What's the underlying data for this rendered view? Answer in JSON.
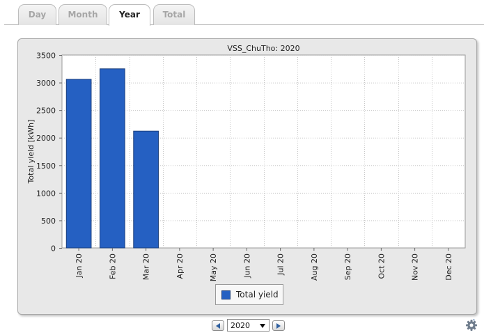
{
  "tabs": [
    {
      "label": "Day",
      "active": false
    },
    {
      "label": "Month",
      "active": false
    },
    {
      "label": "Year",
      "active": true
    },
    {
      "label": "Total",
      "active": false
    }
  ],
  "colors": {
    "bar": "#2560c2",
    "bar_border": "#1c3f7c",
    "accent": "#2f5f9f"
  },
  "legend": {
    "label": "Total yield"
  },
  "year_selector": {
    "value": "2020"
  },
  "icons": {
    "prev": "arrow-left-icon",
    "next": "arrow-right-icon",
    "settings": "gear-icon"
  },
  "chart_data": {
    "type": "bar",
    "title": "VSS_ChuTho: 2020",
    "ylabel": "Total yield [kWh]",
    "xlabel": "",
    "ylim": [
      0,
      3500
    ],
    "yticks": [
      0,
      500,
      1000,
      1500,
      2000,
      2500,
      3000,
      3500
    ],
    "grid": true,
    "legend_position": "bottom",
    "categories": [
      "Jan 20",
      "Feb 20",
      "Mar 20",
      "Apr 20",
      "May 20",
      "Jun 20",
      "Jul 20",
      "Aug 20",
      "Sep 20",
      "Oct 20",
      "Nov 20",
      "Dec 20"
    ],
    "series": [
      {
        "name": "Total yield",
        "values": [
          3060,
          3250,
          2120,
          0,
          0,
          0,
          0,
          0,
          0,
          0,
          0,
          0
        ]
      }
    ]
  }
}
